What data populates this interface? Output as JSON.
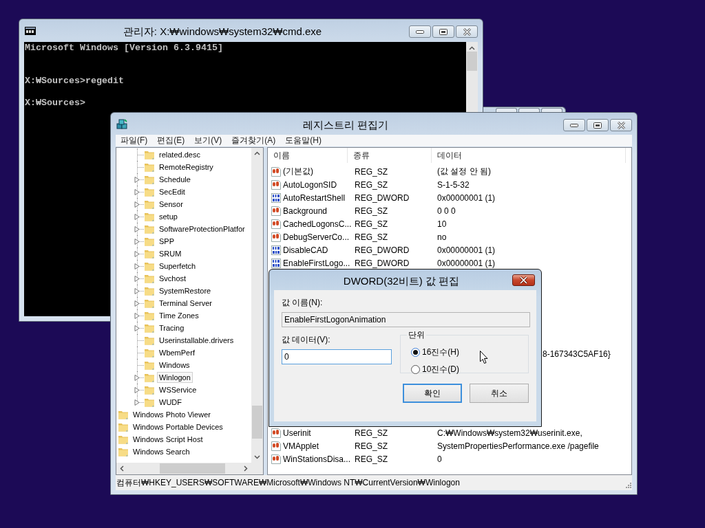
{
  "cmd_window": {
    "title": "관리자: X:₩windows₩system32₩cmd.exe",
    "output": "Microsoft Windows [Version 6.3.9415]\n\n\nX:₩Sources>regedit\n\nX:₩Sources>"
  },
  "regedit": {
    "title": "레지스트리 편집기",
    "menu": [
      "파일(F)",
      "편집(E)",
      "보기(V)",
      "즐겨찾기(A)",
      "도움말(H)"
    ],
    "tree": {
      "items": [
        {
          "children": [
            {
              "label": "related.desc",
              "expandable": false,
              "selected": false
            },
            {
              "label": "RemoteRegistry",
              "expandable": false,
              "selected": false
            },
            {
              "label": "Schedule",
              "expandable": true,
              "selected": false
            },
            {
              "label": "SecEdit",
              "expandable": true,
              "selected": false
            },
            {
              "label": "Sensor",
              "expandable": true,
              "selected": false
            },
            {
              "label": "setup",
              "expandable": true,
              "selected": false
            },
            {
              "label": "SoftwareProtectionPlatfor",
              "expandable": true,
              "selected": false
            },
            {
              "label": "SPP",
              "expandable": true,
              "selected": false
            },
            {
              "label": "SRUM",
              "expandable": true,
              "selected": false
            },
            {
              "label": "Superfetch",
              "expandable": true,
              "selected": false
            },
            {
              "label": "Svchost",
              "expandable": true,
              "selected": false
            },
            {
              "label": "SystemRestore",
              "expandable": true,
              "selected": false
            },
            {
              "label": "Terminal Server",
              "expandable": true,
              "selected": false
            },
            {
              "label": "Time Zones",
              "expandable": true,
              "selected": false
            },
            {
              "label": "Tracing",
              "expandable": true,
              "selected": false
            },
            {
              "label": "Userinstallable.drivers",
              "expandable": false,
              "selected": false
            },
            {
              "label": "WbemPerf",
              "expandable": false,
              "selected": false
            },
            {
              "label": "Windows",
              "expandable": false,
              "selected": false
            },
            {
              "label": "Winlogon",
              "expandable": true,
              "selected": true
            },
            {
              "label": "WSService",
              "expandable": true,
              "selected": false
            },
            {
              "label": "WUDF",
              "expandable": true,
              "selected": false
            }
          ]
        },
        {
          "label": "Windows Photo Viewer",
          "selected": false
        },
        {
          "label": "Windows Portable Devices",
          "selected": false
        },
        {
          "label": "Windows Script Host",
          "selected": false
        },
        {
          "label": "Windows Search",
          "selected": false
        }
      ]
    },
    "values": {
      "columns": [
        "이름",
        "종류",
        "데이터"
      ],
      "rows": [
        {
          "kind": "string",
          "name": "(기본값)",
          "type": "REG_SZ",
          "data": "(값 설정 안 됨)"
        },
        {
          "kind": "string",
          "name": "AutoLogonSID",
          "type": "REG_SZ",
          "data": "S-1-5-32"
        },
        {
          "kind": "dword",
          "name": "AutoRestartShell",
          "type": "REG_DWORD",
          "data": "0x00000001 (1)"
        },
        {
          "kind": "string",
          "name": "Background",
          "type": "REG_SZ",
          "data": "0 0 0"
        },
        {
          "kind": "string",
          "name": "CachedLogonsC...",
          "type": "REG_SZ",
          "data": "10"
        },
        {
          "kind": "string",
          "name": "DebugServerCo...",
          "type": "REG_SZ",
          "data": "no"
        },
        {
          "kind": "dword",
          "name": "DisableCAD",
          "type": "REG_DWORD",
          "data": "0x00000001 (1)"
        },
        {
          "kind": "dword",
          "name": "EnableFirstLogo...",
          "type": "REG_DWORD",
          "data": "0x00000001 (1)"
        },
        {
          "kind": "covered",
          "data": "8-167343C5AF16}"
        },
        {
          "kind": "string",
          "name": "Userinit",
          "type": "REG_SZ",
          "data": "C:₩Windows₩system32₩userinit.exe,"
        },
        {
          "kind": "string",
          "name": "VMApplet",
          "type": "REG_SZ",
          "data": "SystemPropertiesPerformance.exe /pagefile"
        },
        {
          "kind": "string",
          "name": "WinStationsDisa...",
          "type": "REG_SZ",
          "data": "0"
        }
      ]
    },
    "status_bar": "컴퓨터₩HKEY_USERS₩SOFTWARE₩Microsoft₩Windows NT₩CurrentVersion₩Winlogon"
  },
  "dialog": {
    "title": "DWORD(32비트) 값 편집",
    "name_label": "값 이름(N):",
    "name_value": "EnableFirstLogonAnimation",
    "data_label": "값 데이터(V):",
    "data_value": "0",
    "base_group": {
      "title": "단위",
      "options": [
        {
          "label": "16진수(H)",
          "selected": true
        },
        {
          "label": "10진수(D)",
          "selected": false
        }
      ]
    },
    "buttons": [
      {
        "label": "확인",
        "default": true
      },
      {
        "label": "취소",
        "default": false
      }
    ]
  }
}
